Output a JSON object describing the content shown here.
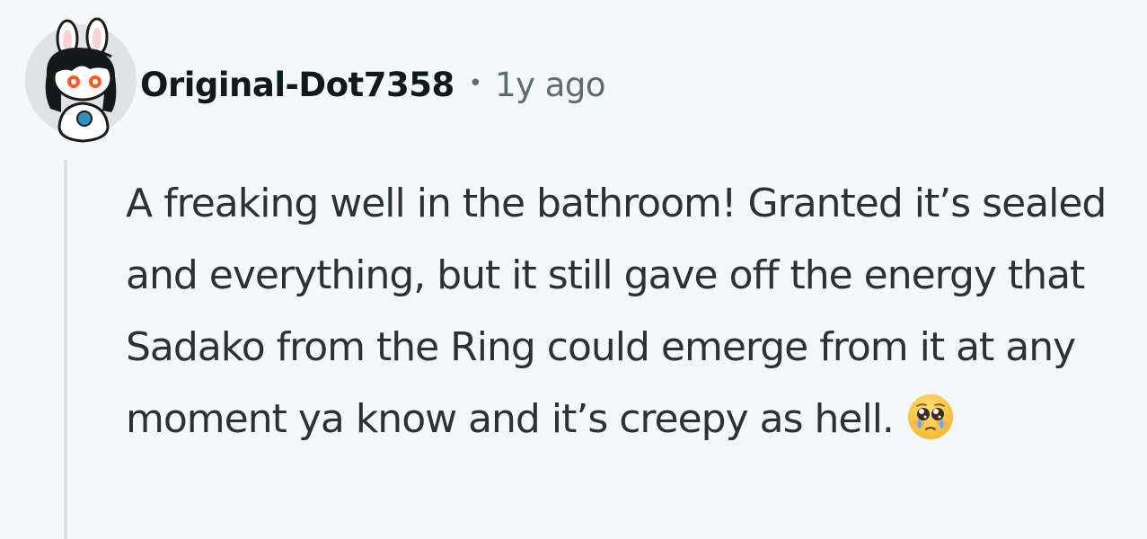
{
  "comment": {
    "author": "Original-Dot7358",
    "separator": "•",
    "timestamp": "1y ago",
    "body": "A freaking well in the bathroom! Granted it’s sealed and everything, but it still gave off the energy that Sadako from the Ring could emerge from it at any moment ya know and it’s creepy as hell.",
    "emoji": "pleading-face-with-tears-icon"
  },
  "colors": {
    "background": "#f5f7f9",
    "author": "#0f1a1c",
    "meta": "#5c6c74",
    "body": "#2a3236",
    "thread_line": "#d9e4ea"
  }
}
